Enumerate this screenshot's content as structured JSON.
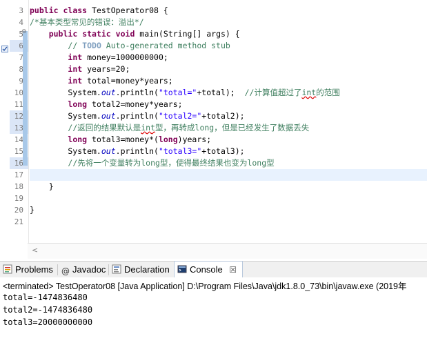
{
  "editor": {
    "line_numbers": [
      "3",
      "4",
      "5",
      "6",
      "7",
      "8",
      "9",
      "10",
      "11",
      "12",
      "13",
      "14",
      "15",
      "16",
      "17",
      "18",
      "19",
      "20",
      "21"
    ],
    "fold_marker": "⊖",
    "lines": [
      [
        {
          "t": "public",
          "c": "kw"
        },
        {
          "t": " "
        },
        {
          "t": "class",
          "c": "kw"
        },
        {
          "t": " TestOperator08 {"
        }
      ],
      [
        {
          "t": "/*基本类型常见的错误：溢出*/",
          "c": "cm"
        }
      ],
      [
        {
          "t": "    "
        },
        {
          "t": "public",
          "c": "kw"
        },
        {
          "t": " "
        },
        {
          "t": "static",
          "c": "kw"
        },
        {
          "t": " "
        },
        {
          "t": "void",
          "c": "kw"
        },
        {
          "t": " main(String[] args) {"
        }
      ],
      [
        {
          "t": "        "
        },
        {
          "t": "// ",
          "c": "cm"
        },
        {
          "t": "TODO",
          "c": "todo"
        },
        {
          "t": " Auto-generated method stub",
          "c": "cm"
        }
      ],
      [
        {
          "t": "        "
        },
        {
          "t": "int",
          "c": "kw"
        },
        {
          "t": " money=1000000000;"
        }
      ],
      [
        {
          "t": "        "
        },
        {
          "t": "int",
          "c": "kw"
        },
        {
          "t": " years=20;"
        }
      ],
      [
        {
          "t": "        "
        },
        {
          "t": "int",
          "c": "kw"
        },
        {
          "t": " total=money*years;"
        }
      ],
      [
        {
          "t": "        System."
        },
        {
          "t": "out",
          "c": "fld"
        },
        {
          "t": ".println("
        },
        {
          "t": "\"total=\"",
          "c": "str"
        },
        {
          "t": "+total);  "
        },
        {
          "t": "//计算值超过了",
          "c": "cm"
        },
        {
          "t": "int",
          "c": "cm sq"
        },
        {
          "t": "的范围",
          "c": "cm"
        }
      ],
      [
        {
          "t": "        "
        },
        {
          "t": "long",
          "c": "kw"
        },
        {
          "t": " total2=money*years;"
        }
      ],
      [
        {
          "t": "        System."
        },
        {
          "t": "out",
          "c": "fld"
        },
        {
          "t": ".println("
        },
        {
          "t": "\"total2=\"",
          "c": "str"
        },
        {
          "t": "+total2);"
        }
      ],
      [
        {
          "t": "        "
        },
        {
          "t": "//返回的结果默认是",
          "c": "cm"
        },
        {
          "t": "int",
          "c": "cm sq"
        },
        {
          "t": "型，再转成",
          "c": "cm"
        },
        {
          "t": "long",
          "c": "cm"
        },
        {
          "t": "，但是已经发生了数据丢失",
          "c": "cm"
        }
      ],
      [
        {
          "t": "        "
        },
        {
          "t": "long",
          "c": "kw"
        },
        {
          "t": " total3=money*("
        },
        {
          "t": "long",
          "c": "kw"
        },
        {
          "t": ")years;"
        }
      ],
      [
        {
          "t": "        System."
        },
        {
          "t": "out",
          "c": "fld"
        },
        {
          "t": ".println("
        },
        {
          "t": "\"total3=\"",
          "c": "str"
        },
        {
          "t": "+total3);"
        }
      ],
      [
        {
          "t": "        "
        },
        {
          "t": "//先将一个变量转为",
          "c": "cm"
        },
        {
          "t": "long",
          "c": "cm"
        },
        {
          "t": "型，使得最终结果也变为",
          "c": "cm"
        },
        {
          "t": "long",
          "c": "cm"
        },
        {
          "t": "型",
          "c": "cm"
        }
      ],
      [
        {
          "t": ""
        }
      ],
      [
        {
          "t": "    }"
        }
      ],
      [
        {
          "t": ""
        }
      ],
      [
        {
          "t": "}"
        }
      ],
      [
        {
          "t": ""
        }
      ]
    ],
    "scroll_left": "<"
  },
  "tabs": [
    {
      "label": "Problems",
      "icon": "problems-icon",
      "active": false
    },
    {
      "label": "Javadoc",
      "icon": "at-icon",
      "active": false
    },
    {
      "label": "Declaration",
      "icon": "declaration-icon",
      "active": false
    },
    {
      "label": "Console",
      "icon": "console-icon",
      "active": true
    }
  ],
  "tab_close": "☒",
  "console": {
    "terminated": "<terminated> TestOperator08 [Java Application] D:\\Program Files\\Java\\jdk1.8.0_73\\bin\\javaw.exe (2019年",
    "output": [
      "total=-1474836480",
      "total2=-1474836480",
      "total3=20000000000"
    ]
  },
  "colors": {
    "keyword": "#7f0055",
    "comment": "#3f7f5f",
    "string": "#2a00ff",
    "field": "#0000c0",
    "todo": "#7f9fbf"
  }
}
